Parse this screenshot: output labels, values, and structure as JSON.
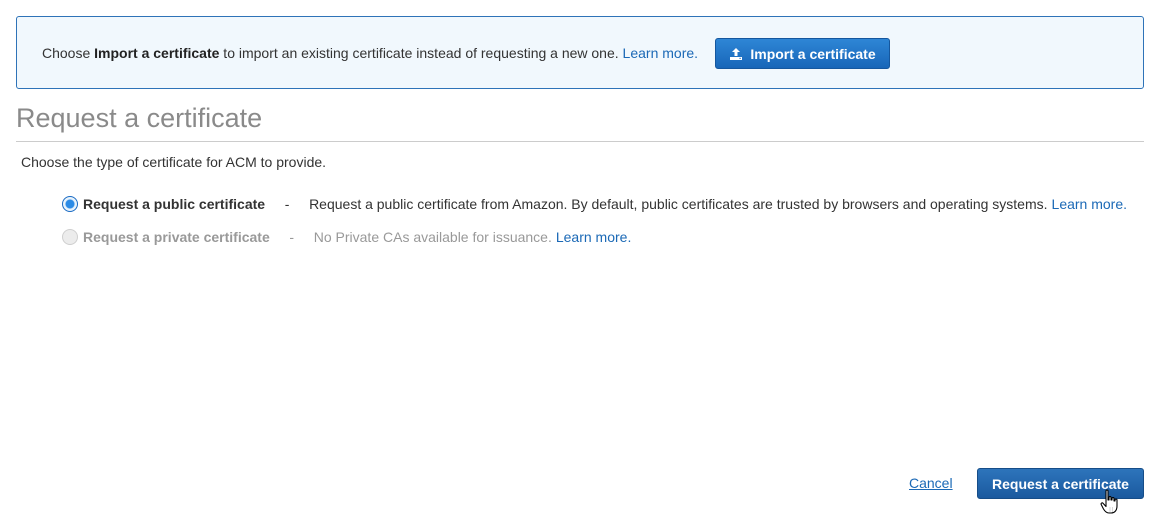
{
  "banner": {
    "text_prefix": "Choose ",
    "text_bold": "Import a certificate",
    "text_suffix": " to import an existing certificate instead of requesting a new one. ",
    "learn_more": "Learn more.",
    "import_button_label": "Import a certificate",
    "import_icon": "upload-icon"
  },
  "page": {
    "title": "Request a certificate",
    "subtitle": "Choose the type of certificate for ACM to provide."
  },
  "options": {
    "public": {
      "label": "Request a public certificate",
      "separator": "-",
      "description": "Request a public certificate from Amazon. By default, public certificates are trusted by browsers and operating systems.",
      "learn_more": "Learn more.",
      "selected": true
    },
    "private": {
      "label": "Request a private certificate",
      "separator": "-",
      "description": "No Private CAs available for issuance.",
      "learn_more": "Learn more.",
      "disabled": true
    }
  },
  "footer": {
    "cancel_label": "Cancel",
    "submit_label": "Request a certificate"
  },
  "colors": {
    "accent": "#1b69b6",
    "banner_bg": "#f1f8fd",
    "title_gray": "#8a8a8a"
  }
}
